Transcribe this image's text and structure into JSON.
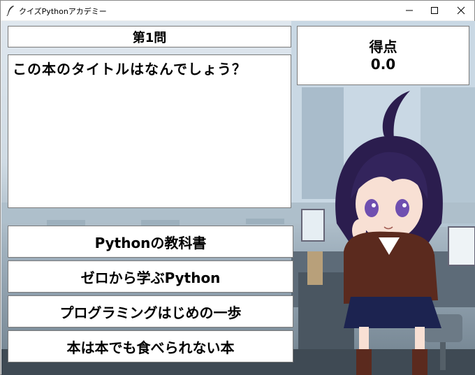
{
  "window": {
    "title": "クイズPythonアカデミー"
  },
  "quiz": {
    "question_number": "第1問",
    "question_text": "この本のタイトルはなんでしょう？",
    "score_label": "得点",
    "score_value": "0.0",
    "answers": [
      "Pythonの教科書",
      "ゼロから学ぶPython",
      "プログラミングはじめの一歩",
      "本は本でも食べられない本"
    ]
  }
}
